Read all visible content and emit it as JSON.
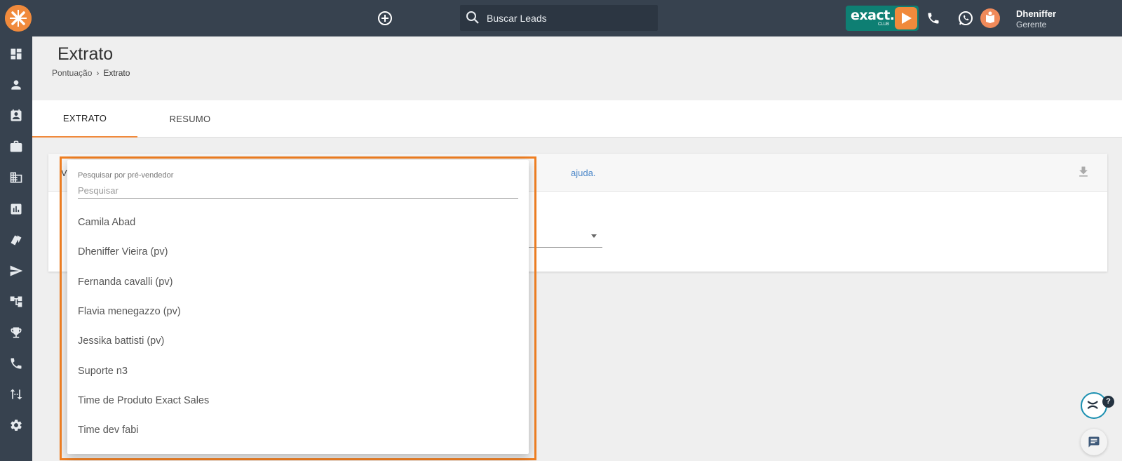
{
  "topbar": {
    "search_placeholder": "Buscar Leads",
    "club_brand": "exact.",
    "club_sub": "CLUB",
    "user_name": "Dheniffer",
    "user_role": "Gerente"
  },
  "sidebar": {
    "icons": [
      "dashboard-icon",
      "person-icon",
      "contact-card-icon",
      "briefcase-icon",
      "building-icon",
      "chart-icon",
      "tags-icon",
      "send-icon",
      "hierarchy-icon",
      "trophy-icon",
      "phone-icon",
      "swap-icon",
      "settings-icon"
    ]
  },
  "page": {
    "title": "Extrato",
    "breadcrumb_parent": "Pontuação",
    "breadcrumb_current": "Extrato"
  },
  "tabs": [
    {
      "label": "EXTRATO",
      "active": true
    },
    {
      "label": "RESUMO",
      "active": false
    }
  ],
  "card": {
    "lead_text": "V",
    "help_link": "ajuda."
  },
  "dropdown": {
    "label": "Pesquisar por pré-vendedor",
    "placeholder": "Pesquisar",
    "items": [
      "Camila Abad",
      "Dheniffer Vieira (pv)",
      "Fernanda cavalli (pv)",
      "Flavia menegazzo (pv)",
      "Jessika battisti (pv)",
      "Suporte n3",
      "Time de Produto Exact Sales",
      "Time dev fabi"
    ]
  },
  "help_fab": {
    "badge": "?"
  },
  "colors": {
    "topbar": "#37424f",
    "accent": "#f08a3c",
    "highlight": "#f07f22",
    "link": "#4a86c8",
    "club": "#0e7f73"
  }
}
